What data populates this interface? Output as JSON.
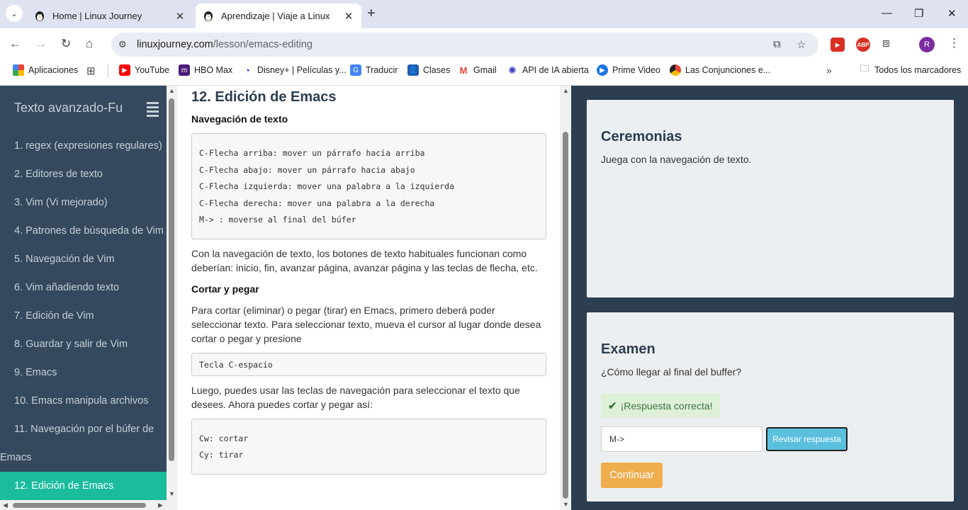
{
  "browser": {
    "tabs": [
      {
        "title": "Home | Linux Journey",
        "active": false
      },
      {
        "title": "Aprendizaje | Viaje a Linux",
        "active": true
      }
    ],
    "url_domain": "linuxjourney.com",
    "url_path": "/lesson/emacs-editing",
    "avatar_letter": "R",
    "extensions": [
      "ABP"
    ],
    "bookmarks": [
      "Aplicaciones",
      "YouTube",
      "HBO Max",
      "Disney+ | Películas y...",
      "Traducir",
      "Clases",
      "Gmail",
      "API de IA abierta",
      "Prime Video",
      "Las Conjunciones e..."
    ],
    "all_bookmarks": "Todos los marcadores"
  },
  "sidebar": {
    "title": "Texto avanzado-Fu",
    "items": [
      "1. regex (expresiones regulares)",
      "2. Editores de texto",
      "3. Vim (Vi mejorado)",
      "4. Patrones de búsqueda de Vim",
      "5. Navegación de Vim",
      "6. Vim añadiendo texto",
      "7. Edición de Vim",
      "8. Guardar y salir de Vim",
      "9. Emacs",
      "10. Emacs manipula archivos",
      "11. Navegación por el búfer de",
      "Emacs"
    ],
    "active_item": "12. Edición de Emacs"
  },
  "content": {
    "title": "12. Edición de Emacs",
    "section1": "Navegación de texto",
    "code1": [
      "C-Flecha arriba: mover un párrafo hacia arriba",
      "C-Flecha abajo: mover un párrafo hacia abajo",
      "C-Flecha izquierda: mover una palabra a la izquierda",
      "C-Flecha derecha: mover una palabra a la derecha",
      "M-> : moverse al final del búfer"
    ],
    "para1": "Con la navegación de texto, los botones de texto habituales funcionan como deberían: inicio, fin, avanzar página, avanzar página y las teclas de flecha, etc.",
    "section2": "Cortar y pegar",
    "para2": "Para cortar (eliminar) o pegar (tirar) en Emacs, primero deberá poder seleccionar texto. Para seleccionar texto, mueva el cursor al lugar donde desea cortar o pegar y presione",
    "code2": "Tecla C-espacio",
    "para3": "Luego, puedes usar las teclas de navegación para seleccionar el texto que desees. Ahora puedes cortar y pegar así:",
    "code3": [
      "Cw: cortar",
      "Cy: tirar"
    ]
  },
  "panel": {
    "exercise_title": "Ceremonias",
    "exercise_text": "Juega con la navegación de texto.",
    "quiz_title": "Examen",
    "quiz_question": "¿Cómo llegar al final del buffer?",
    "success_text": "¡Respuesta correcta!",
    "answer_value": "M->",
    "check_label": "Revisar respuesta",
    "continue_label": "Continuar"
  },
  "colors": {
    "sidebar_bg": "#34495e",
    "sidebar_active": "#1abc9c",
    "panel_bg": "#2c3e50",
    "check_btn": "#5bc0de",
    "continue_btn": "#f0ad4e",
    "success_bg": "#dff0d8"
  }
}
